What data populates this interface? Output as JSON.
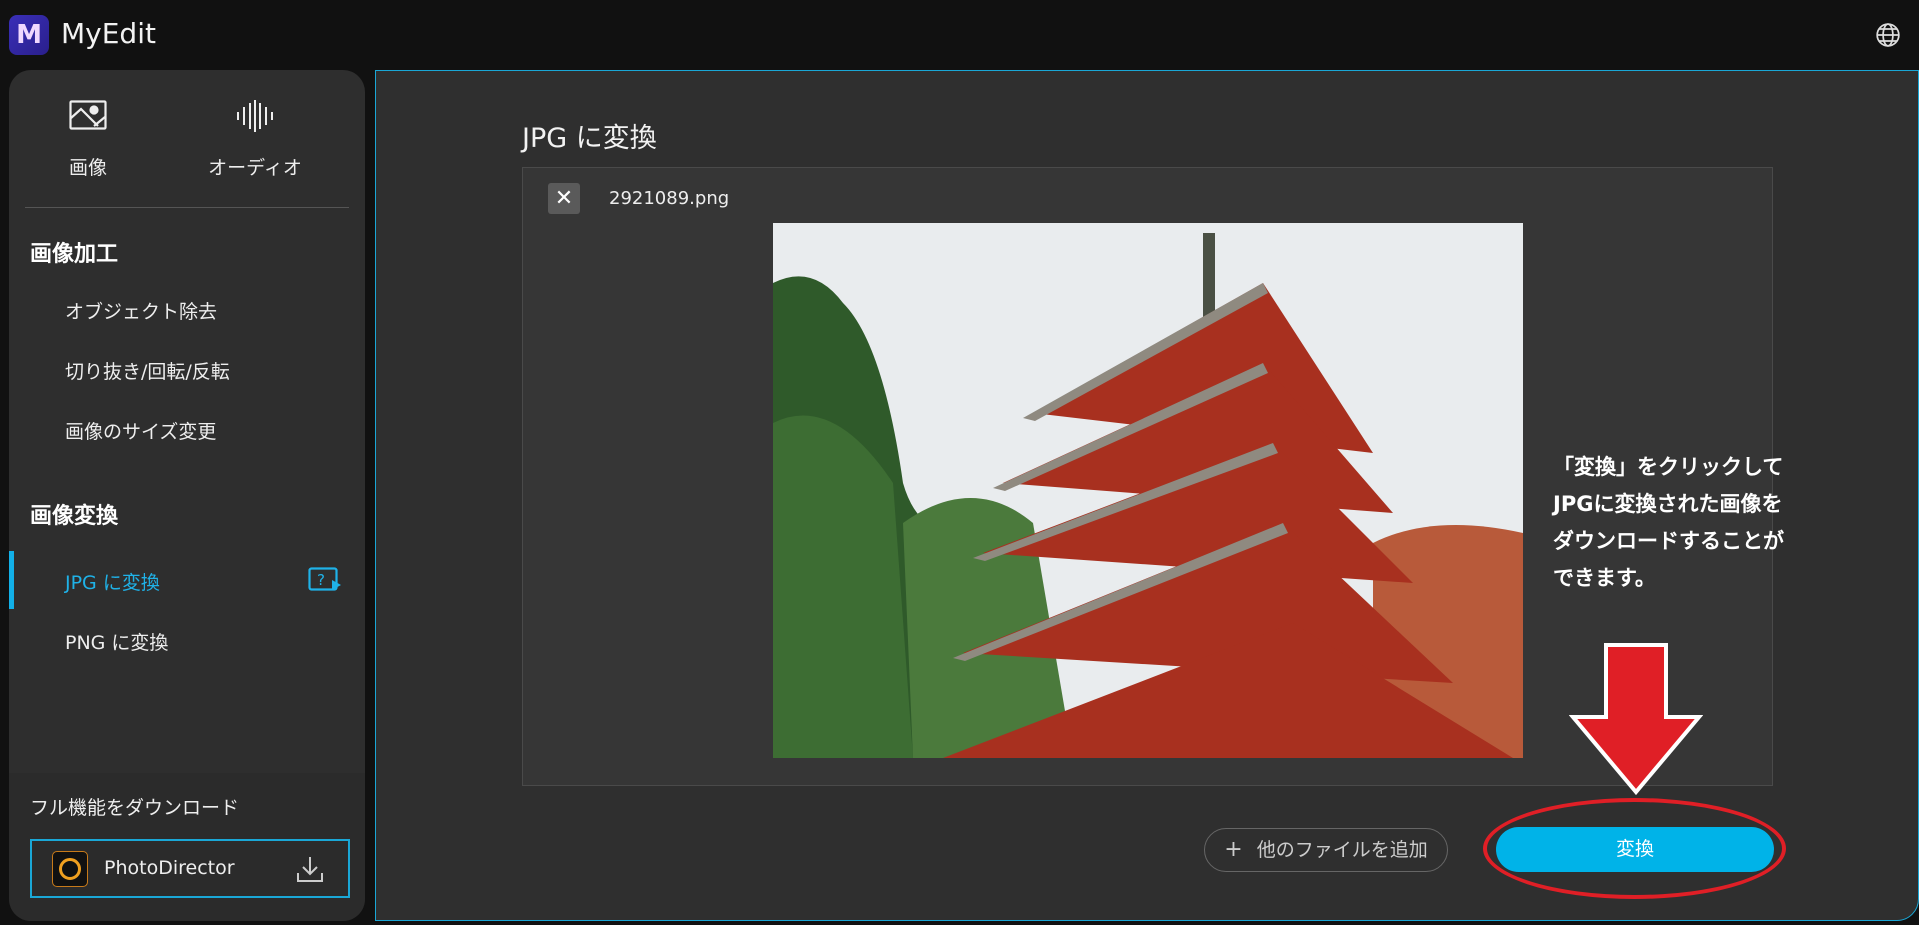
{
  "app": {
    "title": "MyEdit",
    "logo_letter": "M"
  },
  "sidebar": {
    "tabs": [
      {
        "label": "画像",
        "icon": "image-icon"
      },
      {
        "label": "オーディオ",
        "icon": "audio-wave-icon"
      }
    ],
    "sections": [
      {
        "heading": "画像加工",
        "items": [
          "オブジェクト除去",
          "切り抜き/回転/反転",
          "画像のサイズ変更"
        ]
      },
      {
        "heading": "画像変換",
        "items": [
          "JPG に変換",
          "PNG に変換"
        ]
      }
    ],
    "active_item": "JPG に変換",
    "download": {
      "label": "フル機能をダウンロード",
      "app_name": "PhotoDirector"
    }
  },
  "main": {
    "title": "JPG に変換",
    "file": {
      "name": "2921089.png"
    },
    "add_files_label": "他のファイルを追加",
    "convert_label": "変換"
  },
  "annotation": {
    "text": "「変換」をクリックして\nJPGに変換された画像を\nダウンロードすることが\nできます。"
  },
  "colors": {
    "accent": "#00b3e8",
    "annotation_red": "#e01f26"
  }
}
